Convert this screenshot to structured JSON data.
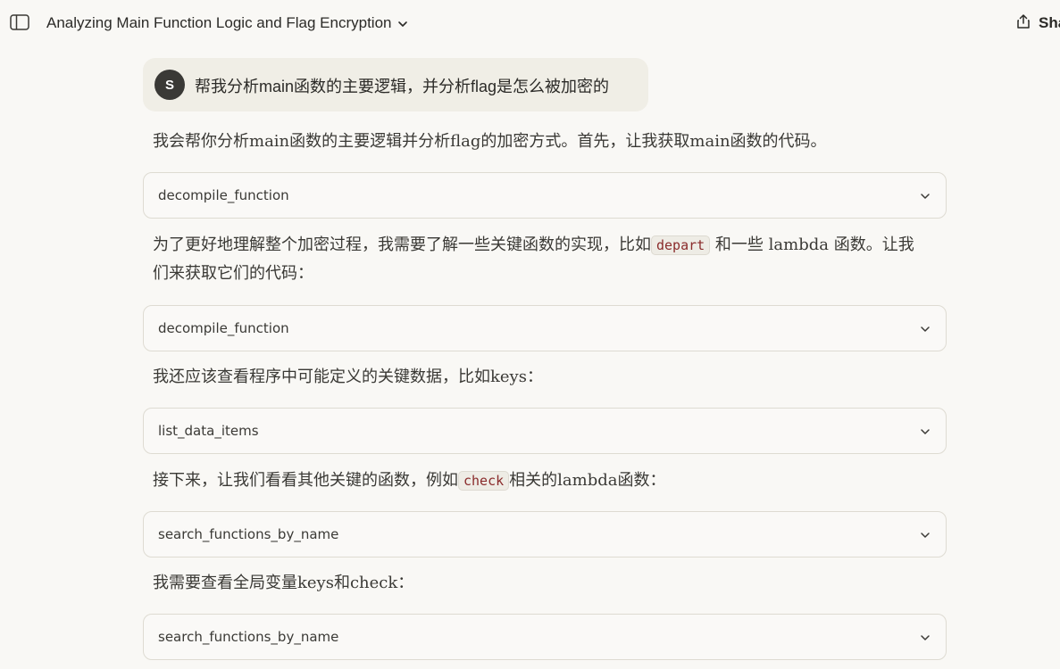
{
  "header": {
    "title": "Analyzing Main Function Logic and Flag Encryption",
    "share_label": "Share"
  },
  "user_message": {
    "avatar_initial": "S",
    "text": "帮我分析main函数的主要逻辑，并分析flag是怎么被加密的"
  },
  "assistant": {
    "p1": "我会帮你分析main函数的主要逻辑并分析flag的加密方式。首先，让我获取main函数的代码。",
    "tool1": "decompile_function",
    "p2_before": "为了更好地理解整个加密过程，我需要了解一些关键函数的实现，比如",
    "p2_code": "depart",
    "p2_after": "和一些 lambda 函数。让我们来获取它们的代码：",
    "tool2": "decompile_function",
    "p3": "我还应该查看程序中可能定义的关键数据，比如keys：",
    "tool3": "list_data_items",
    "p4_before": "接下来，让我们看看其他关键的函数，例如",
    "p4_code": "check",
    "p4_after": "相关的lambda函数：",
    "tool4": "search_functions_by_name",
    "p5": "我需要查看全局变量keys和check：",
    "tool5": "search_functions_by_name"
  },
  "icons": {
    "sidebar": "sidebar-toggle-icon",
    "title_chevron": "chevron-down-icon",
    "share": "share-icon",
    "tool_chevron": "chevron-down-icon"
  }
}
